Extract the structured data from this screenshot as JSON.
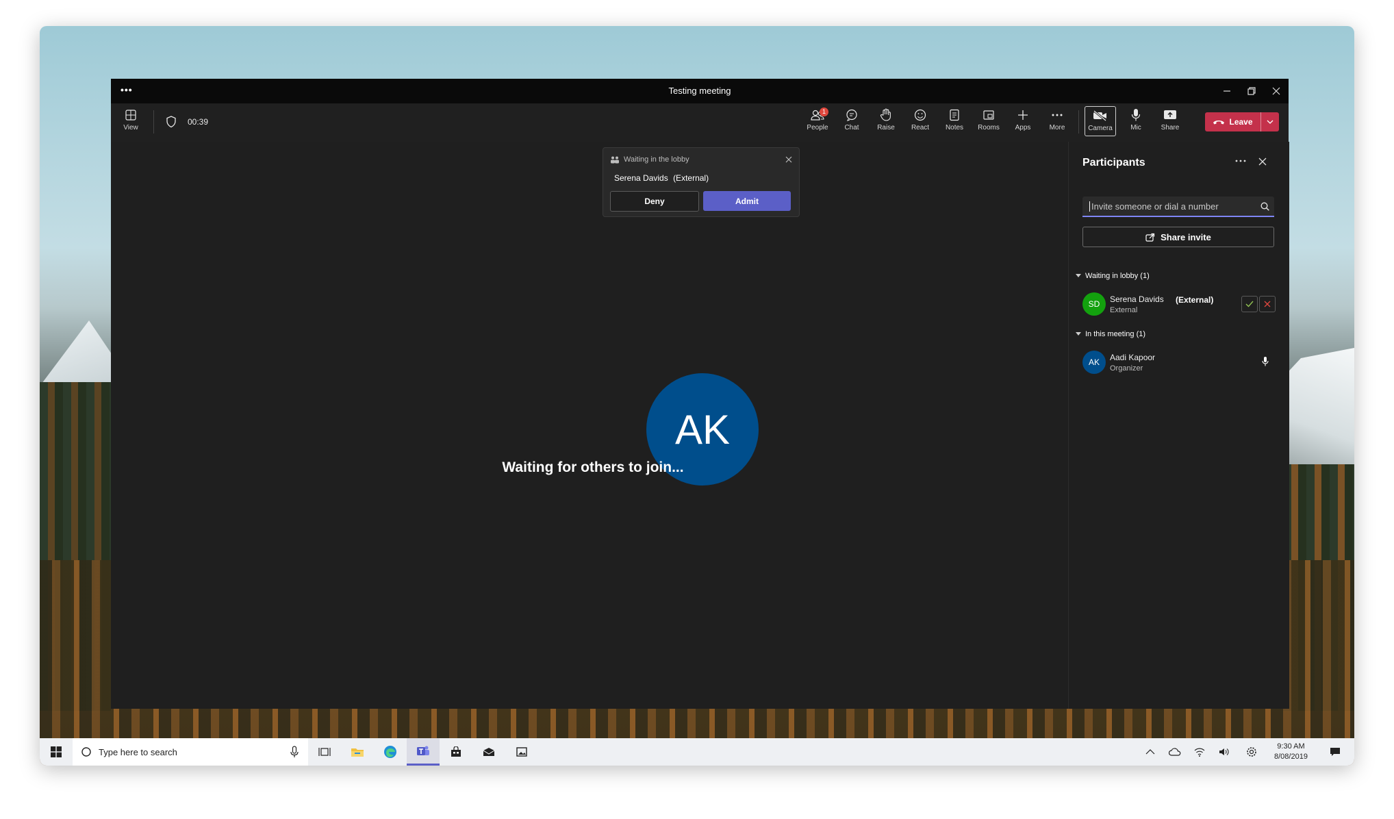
{
  "window": {
    "title": "Testing meeting",
    "menu_dots": "•••"
  },
  "toolbar": {
    "view_label": "View",
    "timer": "00:39",
    "people_label": "People",
    "people_badge": "1",
    "chat_label": "Chat",
    "raise_label": "Raise",
    "react_label": "React",
    "notes_label": "Notes",
    "rooms_label": "Rooms",
    "apps_label": "Apps",
    "more_label": "More",
    "camera_label": "Camera",
    "mic_label": "Mic",
    "share_label": "Share",
    "leave_label": "Leave"
  },
  "lobby_notice": {
    "header": "Waiting in the lobby",
    "name": "Serena Davids",
    "tag": "(External)",
    "deny_label": "Deny",
    "admit_label": "Admit"
  },
  "stage": {
    "avatar_initials": "AK",
    "avatar_color": "#004e8c",
    "waiting_text": "Waiting for others to join..."
  },
  "participants": {
    "title": "Participants",
    "invite_placeholder": "Invite someone or dial a number",
    "share_invite_label": "Share invite",
    "lobby_section": "Waiting in lobby (1)",
    "meeting_section": "In this meeting (1)",
    "lobby": [
      {
        "initials": "SD",
        "name": "Serena Davids",
        "role": "External",
        "tag": "(External)",
        "color": "#13a10e"
      }
    ],
    "meeting": [
      {
        "initials": "AK",
        "name": "Aadi Kapoor",
        "role": "Organizer",
        "color": "#004e8c"
      }
    ]
  },
  "taskbar": {
    "search_placeholder": "Type here to search",
    "time": "9:30 AM",
    "date": "8/08/2019"
  },
  "colors": {
    "accent": "#5b5fc7",
    "leave": "#c4314b"
  }
}
